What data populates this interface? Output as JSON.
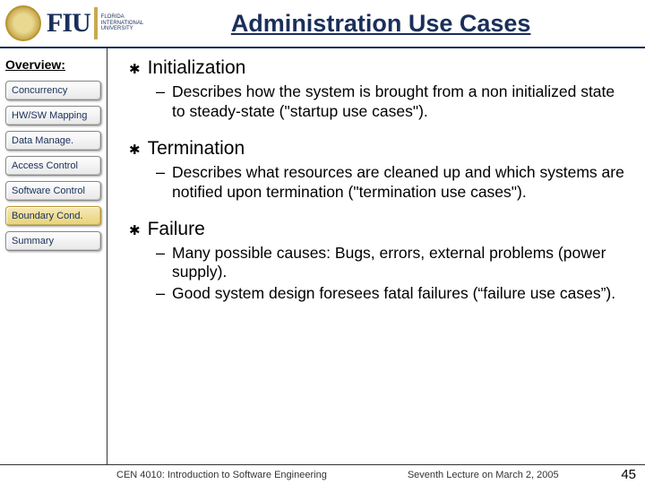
{
  "header": {
    "logo_main": "FIU",
    "logo_sub1": "FLORIDA",
    "logo_sub2": "INTERNATIONAL",
    "logo_sub3": "UNIVERSITY",
    "title": "Administration Use Cases"
  },
  "sidebar": {
    "heading": "Overview:",
    "items": [
      {
        "label": "Concurrency",
        "active": false
      },
      {
        "label": "HW/SW Mapping",
        "active": false
      },
      {
        "label": "Data Manage.",
        "active": false
      },
      {
        "label": "Access Control",
        "active": false
      },
      {
        "label": "Software Control",
        "active": false
      },
      {
        "label": "Boundary Cond.",
        "active": true
      },
      {
        "label": "Summary",
        "active": false
      }
    ]
  },
  "content": {
    "sections": [
      {
        "title": "Initialization",
        "subs": [
          "Describes how the system is brought from a non initialized state to steady-state (\"startup use cases\")."
        ]
      },
      {
        "title": "Termination",
        "subs": [
          "Describes what resources are cleaned up and which systems are notified upon termination (\"termination use cases\")."
        ]
      },
      {
        "title": "Failure",
        "subs": [
          "Many possible causes: Bugs, errors, external problems (power supply).",
          "Good system design foresees fatal failures (“failure use cases”)."
        ]
      }
    ]
  },
  "footer": {
    "left": "CEN 4010: Introduction to Software Engineering",
    "mid": "Seventh Lecture on March 2, 2005",
    "page": "45"
  }
}
